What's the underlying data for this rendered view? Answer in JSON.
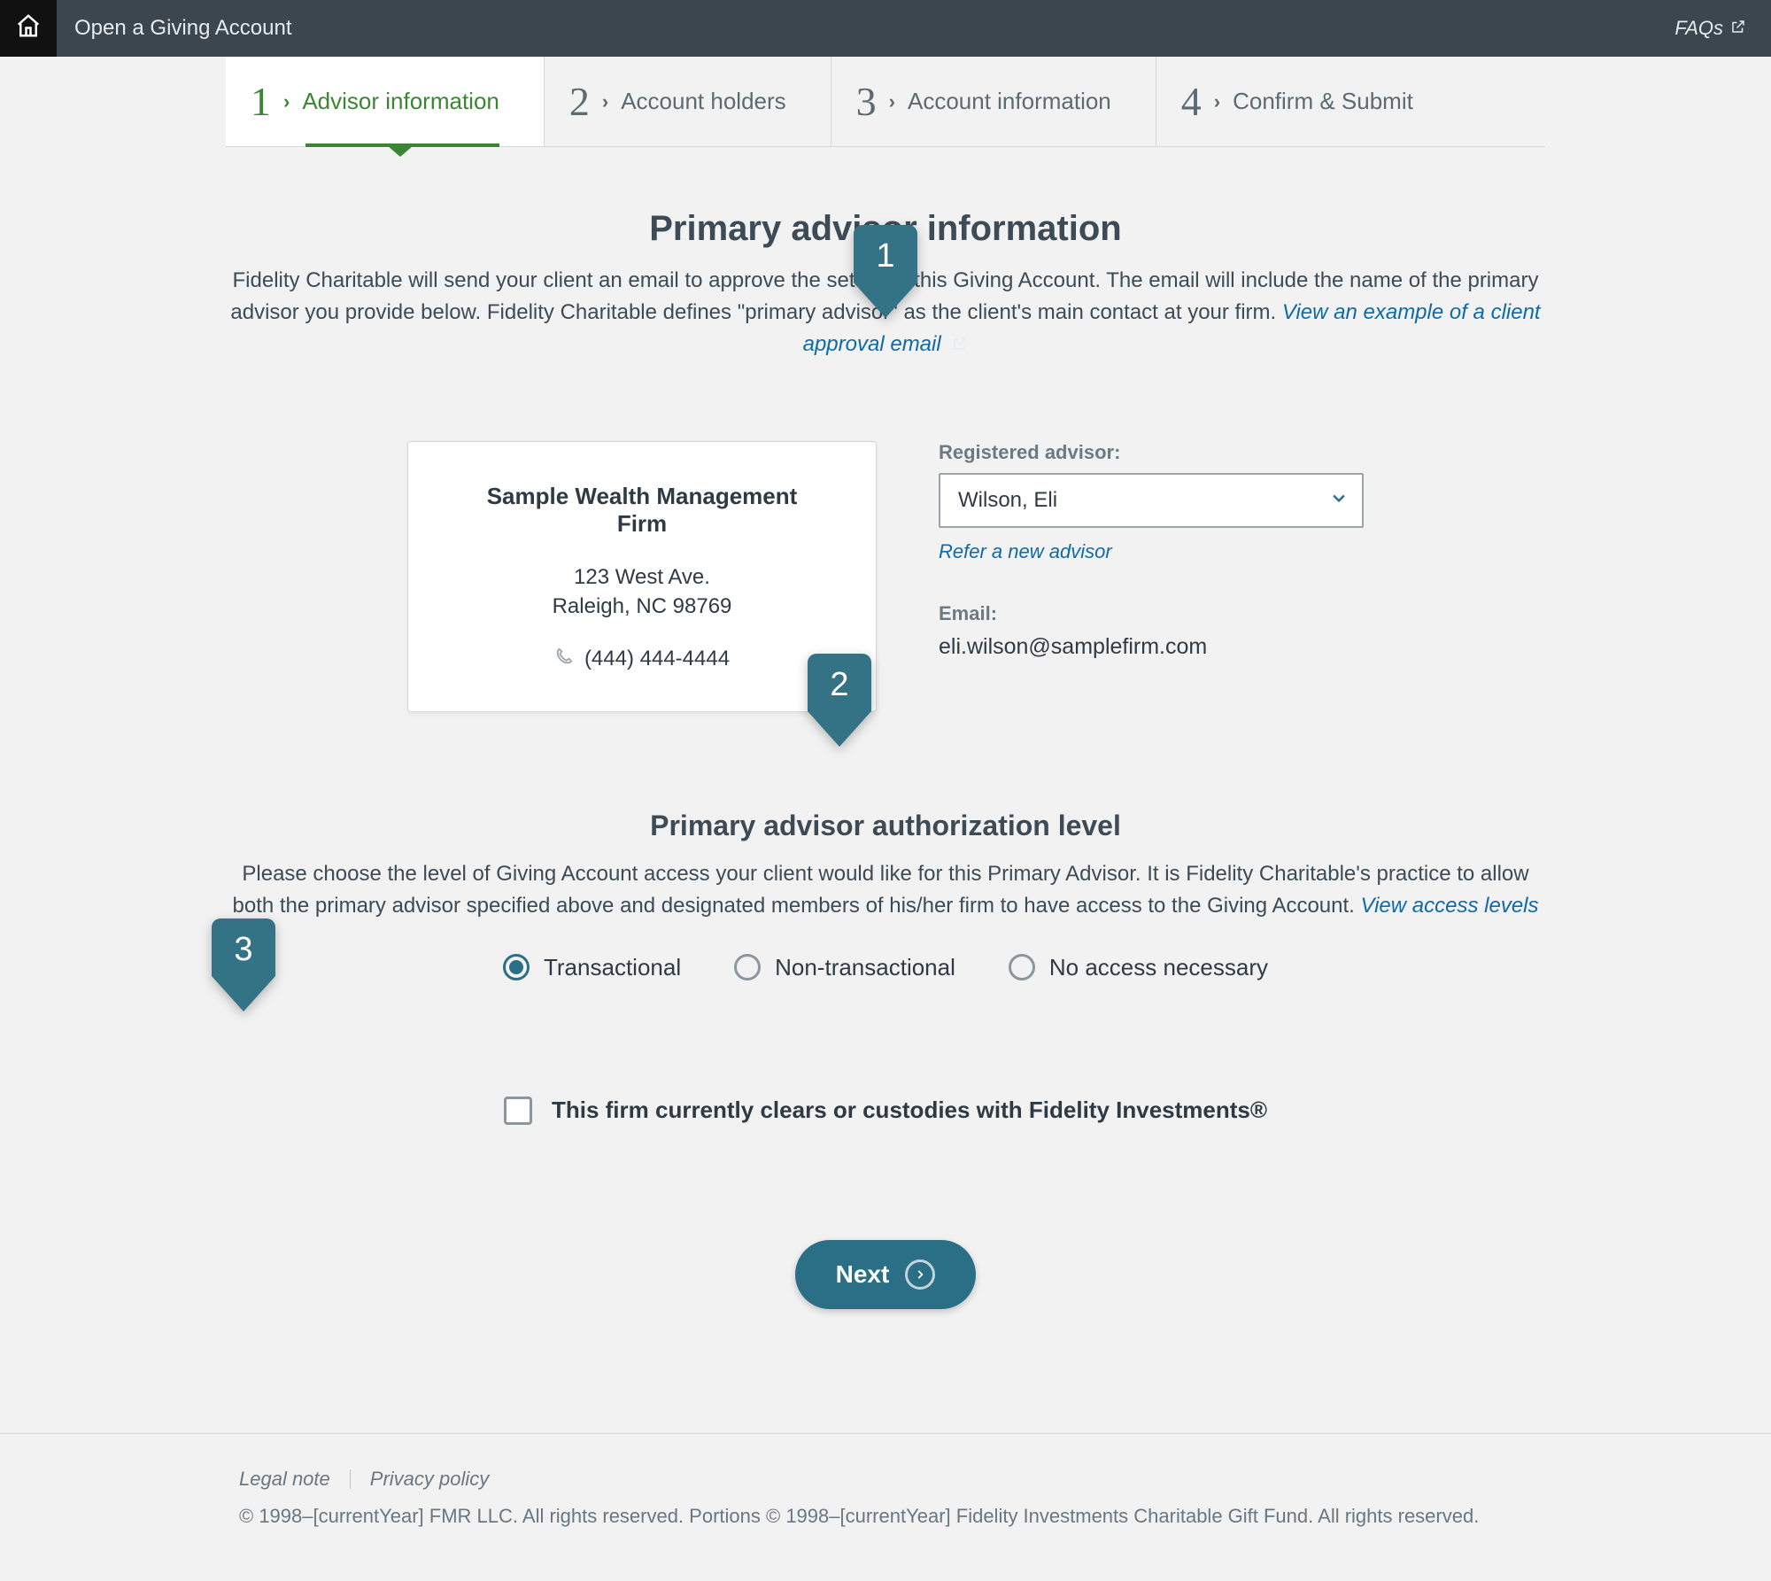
{
  "topbar": {
    "title": "Open a Giving Account",
    "faqs": "FAQs"
  },
  "steps": [
    {
      "num": "1",
      "label": "Advisor information",
      "active": true
    },
    {
      "num": "2",
      "label": "Account holders",
      "active": false
    },
    {
      "num": "3",
      "label": "Account information",
      "active": false
    },
    {
      "num": "4",
      "label": "Confirm & Submit",
      "active": false
    }
  ],
  "section1": {
    "heading": "Primary advisor information",
    "lead_a": "Fidelity Charitable will send your client an email to approve the set up of this Giving Account. The email will include the name of the primary advisor you provide below. Fidelity Charitable defines \"primary advisor\" as the client's main contact at your firm. ",
    "link": "View an example of a client approval email"
  },
  "firm": {
    "name": "Sample Wealth Management Firm",
    "addr1": "123 West Ave.",
    "addr2": "Raleigh, NC 98769",
    "phone": "(444) 444-4444"
  },
  "form": {
    "advisor_label": "Registered advisor:",
    "advisor_value": "Wilson, Eli",
    "refer_link": "Refer a new advisor",
    "email_label": "Email:",
    "email_value": "eli.wilson@samplefirm.com"
  },
  "section2": {
    "heading": "Primary advisor authorization level",
    "lead_a": "Please choose the level of Giving Account access your client would like for this Primary Advisor. It is Fidelity Charitable's practice to allow both the primary advisor specified above and designated members of his/her firm to have access to the Giving Account. ",
    "link": "View access levels"
  },
  "radios": {
    "opt1": "Transactional",
    "opt2": "Non-transactional",
    "opt3": "No access necessary"
  },
  "checkbox_label": "This firm currently clears or custodies with Fidelity Investments®",
  "next": "Next",
  "footer": {
    "legal": "Legal note",
    "privacy": "Privacy policy",
    "copy": "© 1998–[currentYear] FMR LLC. All rights reserved. Portions © 1998–[currentYear] Fidelity Investments Charitable Gift Fund. All rights reserved."
  },
  "callouts": {
    "c1": "1",
    "c2": "2",
    "c3": "3"
  }
}
